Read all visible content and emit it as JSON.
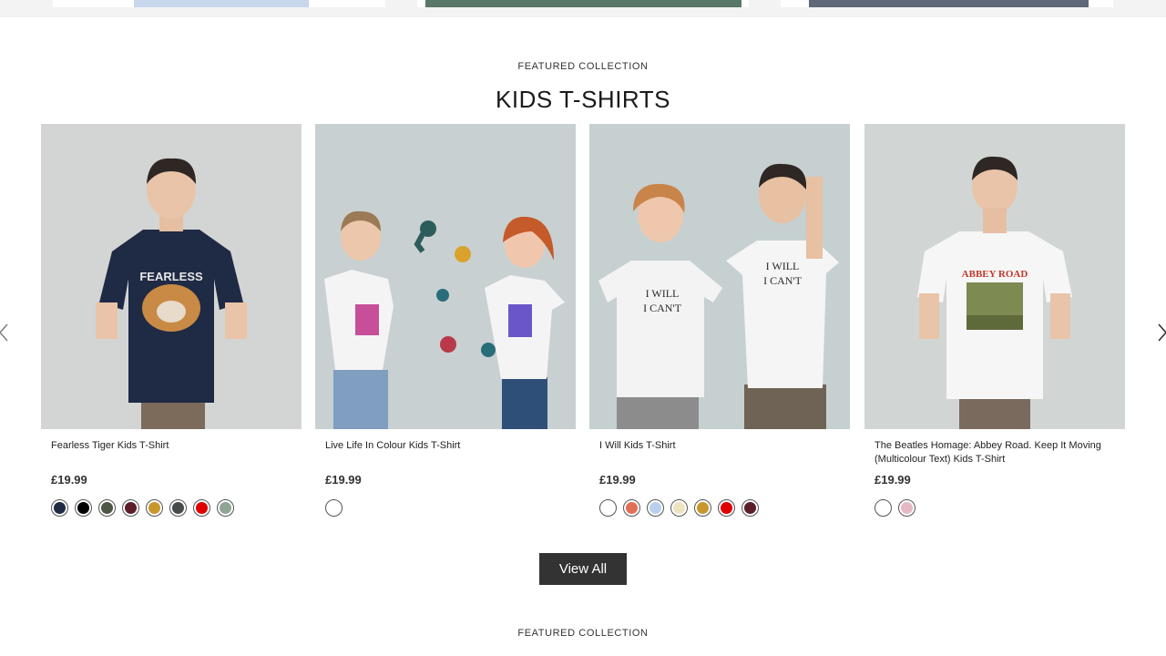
{
  "top_strip": {
    "card_fills": [
      "#c7d7ee",
      "#5a7868",
      "#5e6878"
    ]
  },
  "section": {
    "eyebrow": "FEATURED COLLECTION",
    "title": "KIDS T-SHIRTS"
  },
  "products": [
    {
      "title": "Fearless Tiger Kids T-Shirt",
      "price": "£19.99",
      "image_desc": "boy-navy-tiger-tee",
      "swatches": [
        "#1f2a44",
        "#000000",
        "#4e5646",
        "#5b1e2a",
        "#c8962c",
        "#474b4c",
        "#e00000",
        "#8fa494"
      ]
    },
    {
      "title": "Live Life In Colour Kids T-Shirt",
      "price": "£19.99",
      "image_desc": "kids-handprints-colour-tees",
      "swatches": [
        "#ffffff"
      ]
    },
    {
      "title": "I Will Kids T-Shirt",
      "price": "£19.99",
      "image_desc": "kids-laughing-i-will-tees",
      "swatches": [
        "#ffffff",
        "#e06f55",
        "#b9cfee",
        "#efe3bf",
        "#c8962c",
        "#e00000",
        "#5b1e2a"
      ]
    },
    {
      "title": "The Beatles Homage: Abbey Road. Keep It Moving (Multicolour Text) Kids T-Shirt",
      "price": "£19.99",
      "image_desc": "boy-abbey-road-tee",
      "swatches": [
        "#ffffff",
        "#e6b8c4"
      ]
    }
  ],
  "view_all_label": "View All",
  "next_section": {
    "eyebrow": "FEATURED COLLECTION"
  }
}
